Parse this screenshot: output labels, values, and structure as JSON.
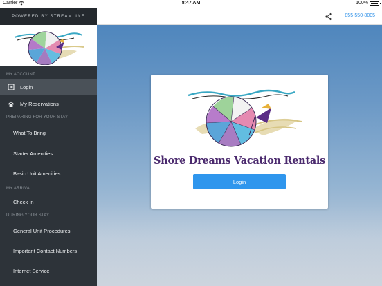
{
  "status_bar": {
    "carrier": "Carrier",
    "time": "8:47 AM",
    "battery": "100%"
  },
  "header": {
    "powered_by": "POWERED BY STREAMLINE",
    "phone": "855-550-8005"
  },
  "sidebar": {
    "sections": {
      "my_account": "MY ACCOUNT",
      "preparing": "PREPARING FOR YOUR STAY",
      "arrival": "MY ARRIVAL",
      "during": "DURING YOUR STAY"
    },
    "items": {
      "login": "Login",
      "reservations": "My Reservations",
      "what_to_bring": "What To Bring",
      "starter_amenities": "Starter Amenities",
      "basic_amenities": "Basic Unit Amenities",
      "check_in": "Check In",
      "general_procedures": "General Unit Procedures",
      "contact_numbers": "Important Contact Numbers",
      "internet": "Internet Service"
    },
    "active_item": "login"
  },
  "card": {
    "title": "Shore Dreams Vacation Rentals",
    "login_label": "Login"
  },
  "colors": {
    "sidebar": "#2d3339",
    "accent": "#2f96ed",
    "brand": "#4b2a6e"
  }
}
